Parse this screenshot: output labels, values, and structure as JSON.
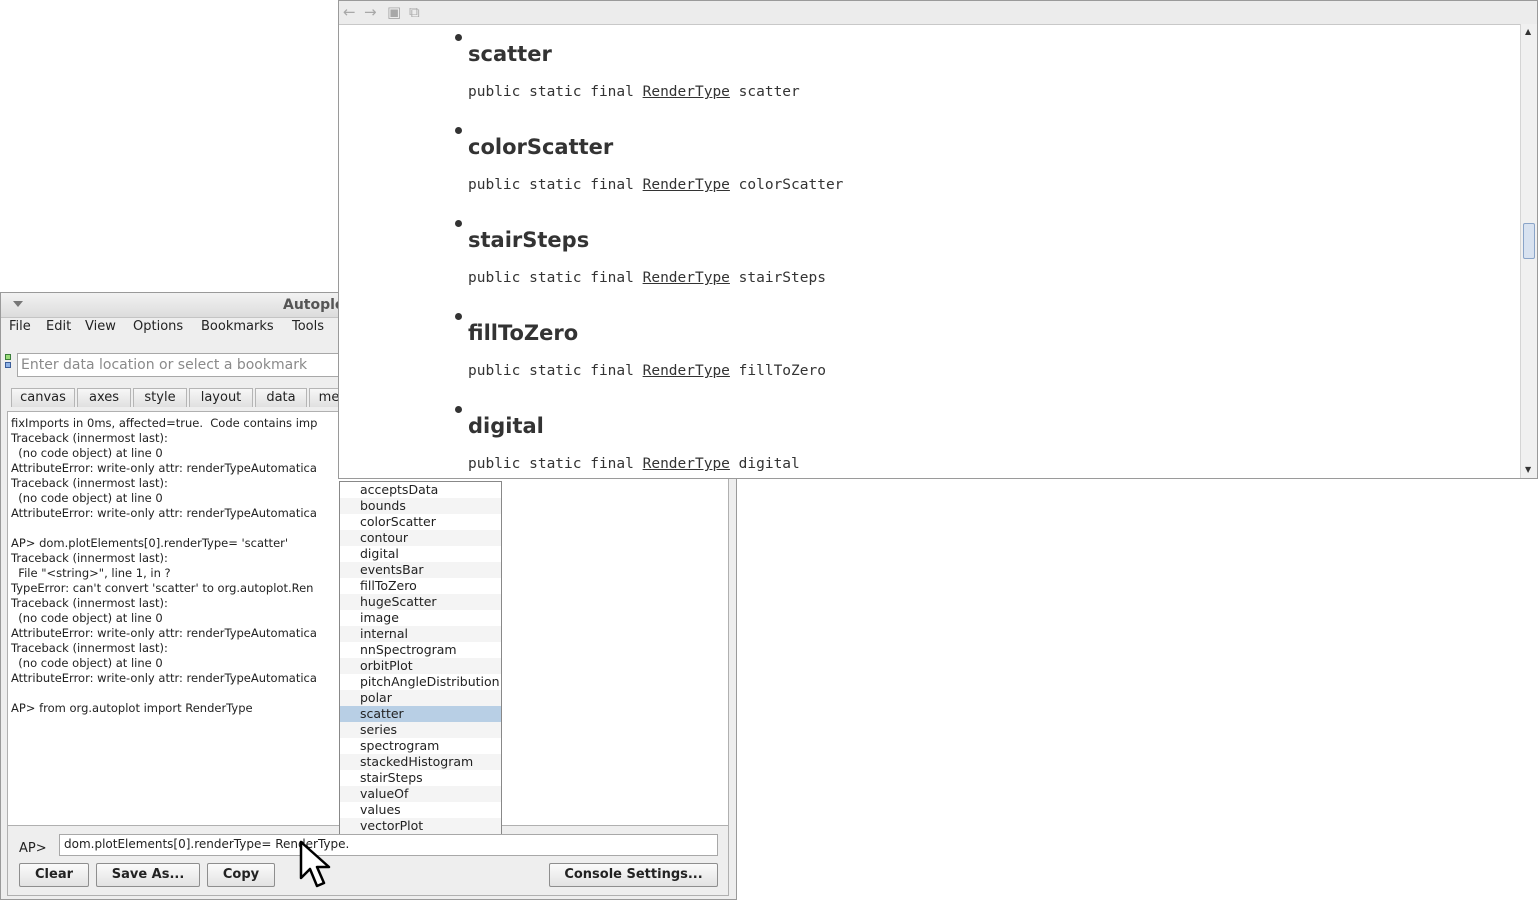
{
  "app": {
    "title": "Autoplot",
    "menu": [
      "File",
      "Edit",
      "View",
      "Options",
      "Bookmarks",
      "Tools"
    ],
    "url_placeholder": "Enter data location or select a bookmark",
    "tabs": [
      "canvas",
      "axes",
      "style",
      "layout",
      "data",
      "me"
    ],
    "console_lines": [
      "fixImports in 0ms, affected=true.  Code contains imp",
      "Traceback (innermost last):",
      "  (no code object) at line 0",
      "AttributeError: write-only attr: renderTypeAutomatica",
      "Traceback (innermost last):",
      "  (no code object) at line 0",
      "AttributeError: write-only attr: renderTypeAutomatica",
      "",
      "AP> dom.plotElements[0].renderType= 'scatter'",
      "Traceback (innermost last):",
      "  File \"<string>\", line 1, in ?",
      "TypeError: can't convert 'scatter' to org.autoplot.Ren",
      "Traceback (innermost last):",
      "  (no code object) at line 0",
      "AttributeError: write-only attr: renderTypeAutomatica",
      "Traceback (innermost last):",
      "  (no code object) at line 0",
      "AttributeError: write-only attr: renderTypeAutomatica",
      "",
      "AP> from org.autoplot import RenderType"
    ],
    "prompt": "AP>",
    "command_value": "dom.plotElements[0].renderType= RenderType.",
    "buttons": {
      "clear": "Clear",
      "save_as": "Save As...",
      "copy": "Copy",
      "console_settings": "Console Settings..."
    }
  },
  "help": {
    "items": [
      {
        "name": "scatter",
        "sig_prefix": "public static final ",
        "type": "RenderType",
        "sig_suffix": " scatter"
      },
      {
        "name": "colorScatter",
        "sig_prefix": "public static final ",
        "type": "RenderType",
        "sig_suffix": " colorScatter"
      },
      {
        "name": "stairSteps",
        "sig_prefix": "public static final ",
        "type": "RenderType",
        "sig_suffix": " stairSteps"
      },
      {
        "name": "fillToZero",
        "sig_prefix": "public static final ",
        "type": "RenderType",
        "sig_suffix": " fillToZero"
      },
      {
        "name": "digital",
        "sig_prefix": "public static final ",
        "type": "RenderType",
        "sig_suffix": " digital"
      }
    ]
  },
  "completion": {
    "options": [
      "acceptsData",
      "bounds",
      "colorScatter",
      "contour",
      "digital",
      "eventsBar",
      "fillToZero",
      "hugeScatter",
      "image",
      "internal",
      "nnSpectrogram",
      "orbitPlot",
      "pitchAngleDistribution",
      "polar",
      "scatter",
      "series",
      "spectrogram",
      "stackedHistogram",
      "stairSteps",
      "valueOf",
      "values",
      "vectorPlot"
    ],
    "selected": "scatter",
    "selected_color": "#b8cfe5"
  }
}
